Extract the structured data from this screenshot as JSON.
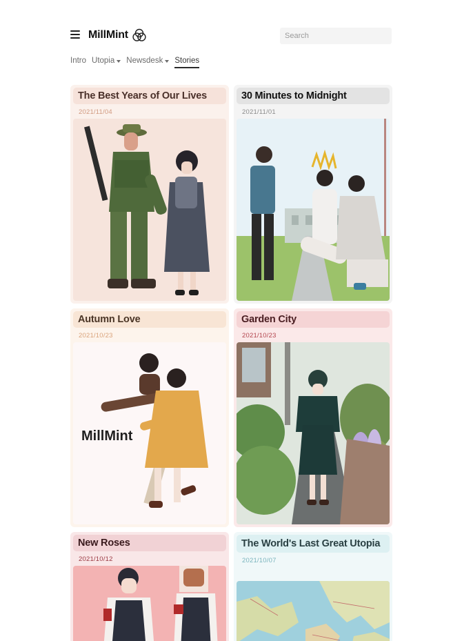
{
  "brand": {
    "name": "MillMint",
    "logo_icon": "three-circles-logo-icon"
  },
  "search": {
    "placeholder": "Search"
  },
  "nav": {
    "items": [
      {
        "label": "Intro",
        "has_dropdown": false,
        "active": false
      },
      {
        "label": "Utopia",
        "has_dropdown": true,
        "active": false
      },
      {
        "label": "Newsdesk",
        "has_dropdown": true,
        "active": false
      },
      {
        "label": "Stories",
        "has_dropdown": false,
        "active": true
      }
    ]
  },
  "stories": [
    {
      "title": "The Best Years of Our Lives",
      "date": "2021/11/04",
      "card_bg": "#fbf1ec",
      "title_bg": "#f6e2da",
      "title_color": "#4a302a",
      "date_color": "#d19a80",
      "image_bg": "#f6e4dc"
    },
    {
      "title": "30 Minutes to Midnight",
      "date": "2021/11/01",
      "card_bg": "#f4f4f4",
      "title_bg": "#e3e3e3",
      "title_color": "#111111",
      "date_color": "#8b8b8b",
      "image_bg": "#e7f2f7"
    },
    {
      "title": "Autumn Love",
      "date": "2021/10/23",
      "card_bg": "#fdf4ec",
      "title_bg": "#f8e5d5",
      "title_color": "#4a3526",
      "date_color": "#d9a27a",
      "image_bg": "#fdf7f7",
      "image_text": "MillMint"
    },
    {
      "title": "Garden City",
      "date": "2021/10/23",
      "card_bg": "#fbe9e9",
      "title_bg": "#f5d4d5",
      "title_color": "#4a1e22",
      "date_color": "#b3444d",
      "image_bg": "#8a9a86"
    },
    {
      "title": "New Roses",
      "date": "2021/10/12",
      "card_bg": "#f9e7e8",
      "title_bg": "#f1d2d5",
      "title_color": "#3a1a1d",
      "date_color": "#9b3a43",
      "image_bg": "#f3b3b3"
    },
    {
      "title": "The World's Last Great Utopia",
      "date": "2021/10/07",
      "card_bg": "#f0f8f9",
      "title_bg": "#ddf0f2",
      "title_color": "#2a4043",
      "date_color": "#7ab4bd",
      "image_bg": "#9fd0dd"
    }
  ]
}
